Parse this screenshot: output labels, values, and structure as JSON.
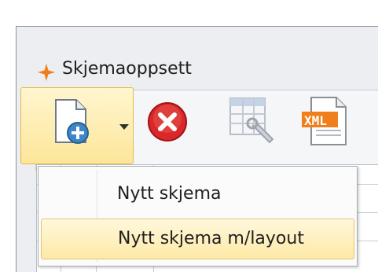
{
  "window": {
    "title": "Skjemaoppsett",
    "title_icon": "orange-star-icon"
  },
  "toolbar": {
    "new_form_icon": "new-document-icon",
    "delete_icon": "delete-x-icon",
    "table_settings_icon": "table-wrench-icon",
    "xml_icon_text": "XML",
    "accent_color": "#f07f1b"
  },
  "menu": {
    "items": [
      {
        "label": "Nytt skjema"
      },
      {
        "label": "Nytt skjema m/layout",
        "highlighted": true
      }
    ]
  }
}
